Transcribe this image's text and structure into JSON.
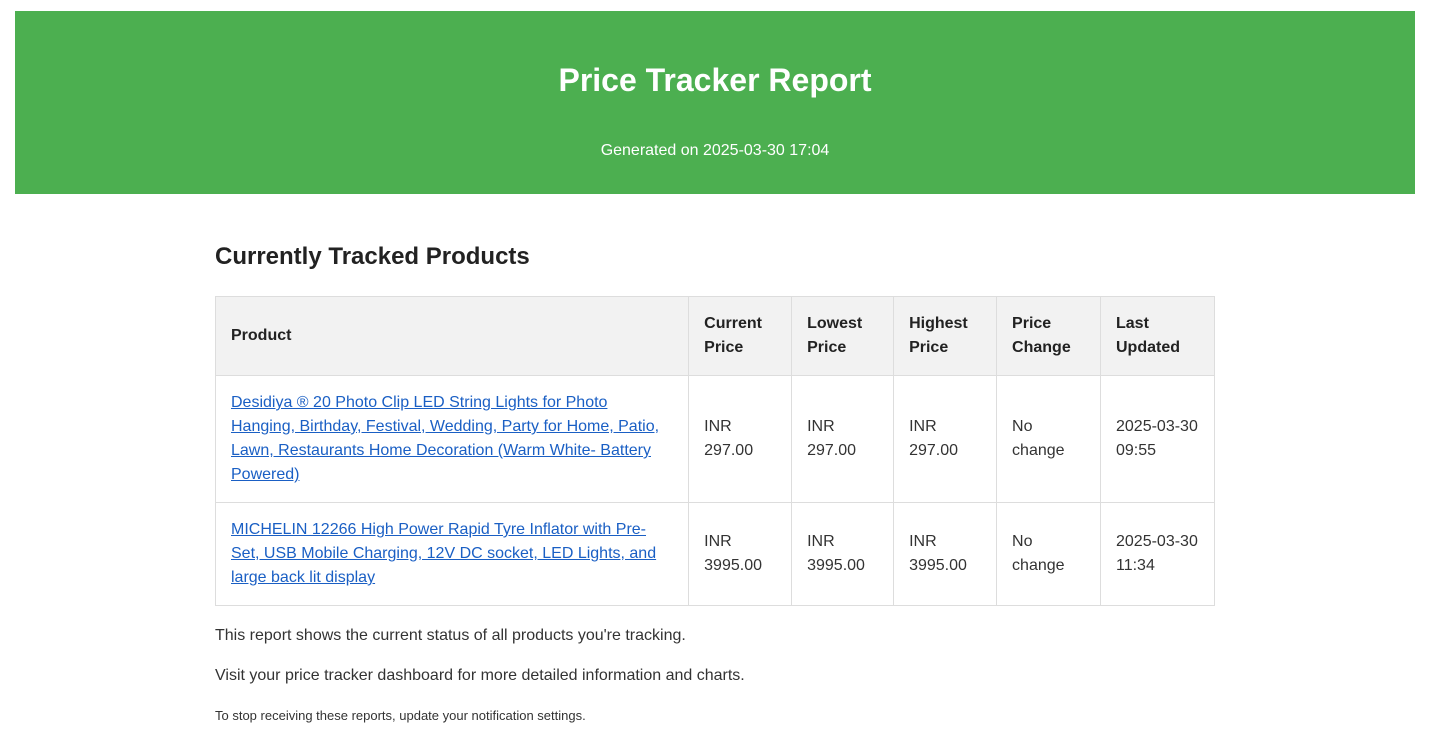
{
  "header": {
    "title": "Price Tracker Report",
    "generated": "Generated on 2025-03-30 17:04"
  },
  "section": {
    "title": "Currently Tracked Products"
  },
  "table": {
    "headers": {
      "product": "Product",
      "current": "Current Price",
      "lowest": "Lowest Price",
      "highest": "Highest Price",
      "change": "Price Change",
      "updated": "Last Updated"
    },
    "rows": [
      {
        "product": "Desidiya ® 20 Photo Clip LED String Lights for Photo Hanging, Birthday, Festival, Wedding, Party for Home, Patio, Lawn, Restaurants Home Decoration (Warm White- Battery Powered)",
        "current": "INR 297.00",
        "lowest": "INR 297.00",
        "highest": "INR 297.00",
        "change": "No change",
        "updated": "2025-03-30 09:55"
      },
      {
        "product": "MICHELIN 12266 High Power Rapid Tyre Inflator with Pre-Set, USB Mobile Charging, 12V DC socket, LED Lights, and large back lit display",
        "current": "INR 3995.00",
        "lowest": "INR 3995.00",
        "highest": "INR 3995.00",
        "change": "No change",
        "updated": "2025-03-30 11:34"
      }
    ]
  },
  "notes": {
    "status": "This report shows the current status of all products you're tracking.",
    "dashboard": "Visit your price tracker dashboard for more detailed information and charts.",
    "unsubscribe": "To stop receiving these reports, update your notification settings."
  },
  "colors": {
    "header_bg": "#4caf50",
    "link": "#1a5fc4",
    "table_header_bg": "#f2f2f2",
    "border": "#dddddd"
  }
}
